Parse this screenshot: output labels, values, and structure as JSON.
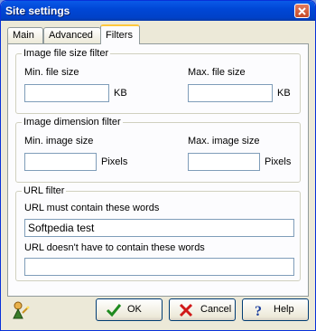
{
  "window": {
    "title": "Site settings"
  },
  "tabs": [
    {
      "label": "Main"
    },
    {
      "label": "Advanced"
    },
    {
      "label": "Filters"
    }
  ],
  "size_filter": {
    "legend": "Image file size filter",
    "min_label": "Min. file size",
    "min_value": "",
    "min_unit": "KB",
    "max_label": "Max. file size",
    "max_value": "",
    "max_unit": "KB"
  },
  "dimension_filter": {
    "legend": "Image dimension filter",
    "min_label": "Min. image size",
    "min_value": "",
    "min_unit": "Pixels",
    "max_label": "Max. image size",
    "max_value": "",
    "max_unit": "Pixels"
  },
  "url_filter": {
    "legend": "URL filter",
    "must_label": "URL must contain these words",
    "must_value": "Softpedia test",
    "not_label": "URL doesn't have to contain these words",
    "not_value": ""
  },
  "buttons": {
    "ok": "OK",
    "cancel": "Cancel",
    "help": "Help"
  },
  "icons": {
    "wizard": "wizard-icon",
    "ok": "checkmark-icon",
    "cancel": "cross-icon",
    "help": "help-icon"
  },
  "colors": {
    "accent": "#0054e3",
    "tab_highlight": "#ffc83c"
  }
}
